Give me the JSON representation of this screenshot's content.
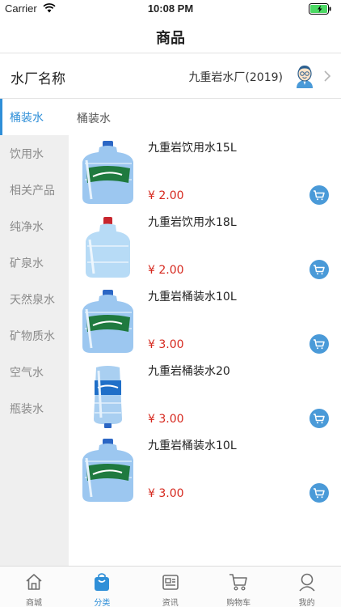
{
  "status_bar": {
    "carrier": "Carrier",
    "time": "10:08 PM"
  },
  "nav": {
    "title": "商品"
  },
  "factory": {
    "label": "水厂名称",
    "value": "九重岩水厂(2019)"
  },
  "sidebar": {
    "active_index": 0,
    "items": [
      {
        "label": "桶装水"
      },
      {
        "label": "饮用水"
      },
      {
        "label": "相关产品"
      },
      {
        "label": "纯净水"
      },
      {
        "label": "矿泉水"
      },
      {
        "label": "天然泉水"
      },
      {
        "label": "矿物质水"
      },
      {
        "label": "空气水"
      },
      {
        "label": "瓶装水"
      }
    ]
  },
  "content": {
    "section_title": "桶装水",
    "products": [
      {
        "name": "九重岩饮用水15L",
        "price": "¥ 2.00",
        "image": "bottle-green-label"
      },
      {
        "name": "九重岩饮用水18L",
        "price": "¥ 2.00",
        "image": "bottle-plain"
      },
      {
        "name": "九重岩桶装水10L",
        "price": "¥ 3.00",
        "image": "bottle-green-label"
      },
      {
        "name": "九重岩桶装水20",
        "price": "¥ 3.00",
        "image": "bottle-blue-label"
      },
      {
        "name": "九重岩桶装水10L",
        "price": "¥ 3.00",
        "image": "bottle-green-label"
      }
    ]
  },
  "tab_bar": {
    "active_index": 1,
    "tabs": [
      {
        "label": "商城",
        "icon": "home-icon"
      },
      {
        "label": "分类",
        "icon": "bag-icon"
      },
      {
        "label": "资讯",
        "icon": "news-icon"
      },
      {
        "label": "购物车",
        "icon": "cart-icon"
      },
      {
        "label": "我的",
        "icon": "user-icon"
      }
    ]
  },
  "colors": {
    "accent": "#2f8fd8",
    "price": "#d6281e",
    "cart_button": "#4a9ad8",
    "battery": "#4cd964"
  }
}
